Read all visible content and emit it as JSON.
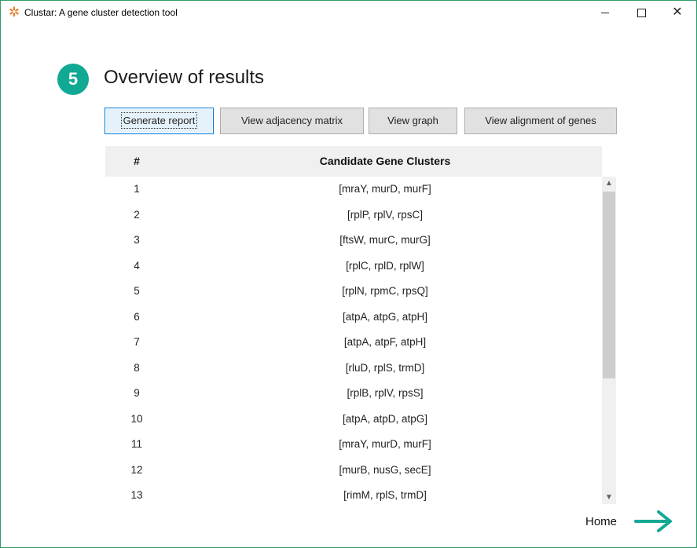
{
  "window": {
    "title": "Clustar: A gene cluster detection tool",
    "app_icon": "asterisk-logo-icon",
    "controls": {
      "minimize": "minimize-icon",
      "maximize": "maximize-icon",
      "close": "✕"
    }
  },
  "header": {
    "step": "5",
    "title": "Overview of results"
  },
  "toolbar": {
    "generate_report": "Generate report",
    "view_adjacency_matrix": "View adjacency matrix",
    "view_graph": "View graph",
    "view_alignment": "View alignment of genes"
  },
  "table": {
    "columns": [
      "#",
      "Candidate Gene Clusters"
    ],
    "rows": [
      {
        "num": "1",
        "cluster": "[mraY, murD, murF]"
      },
      {
        "num": "2",
        "cluster": "[rplP, rplV, rpsC]"
      },
      {
        "num": "3",
        "cluster": "[ftsW, murC, murG]"
      },
      {
        "num": "4",
        "cluster": "[rplC, rplD, rplW]"
      },
      {
        "num": "5",
        "cluster": "[rplN, rpmC, rpsQ]"
      },
      {
        "num": "6",
        "cluster": "[atpA, atpG, atpH]"
      },
      {
        "num": "7",
        "cluster": "[atpA, atpF, atpH]"
      },
      {
        "num": "8",
        "cluster": "[rluD, rplS, trmD]"
      },
      {
        "num": "9",
        "cluster": "[rplB, rplV, rpsS]"
      },
      {
        "num": "10",
        "cluster": "[atpA, atpD, atpG]"
      },
      {
        "num": "11",
        "cluster": "[mraY, murD, murF]"
      },
      {
        "num": "12",
        "cluster": "[murB, nusG, secE]"
      },
      {
        "num": "13",
        "cluster": "[rimM, rplS, trmD]"
      }
    ]
  },
  "footer": {
    "home_label": "Home"
  },
  "colors": {
    "accent": "#11a894",
    "window_border": "#2e9c6a",
    "app_icon": "#e8791f"
  }
}
